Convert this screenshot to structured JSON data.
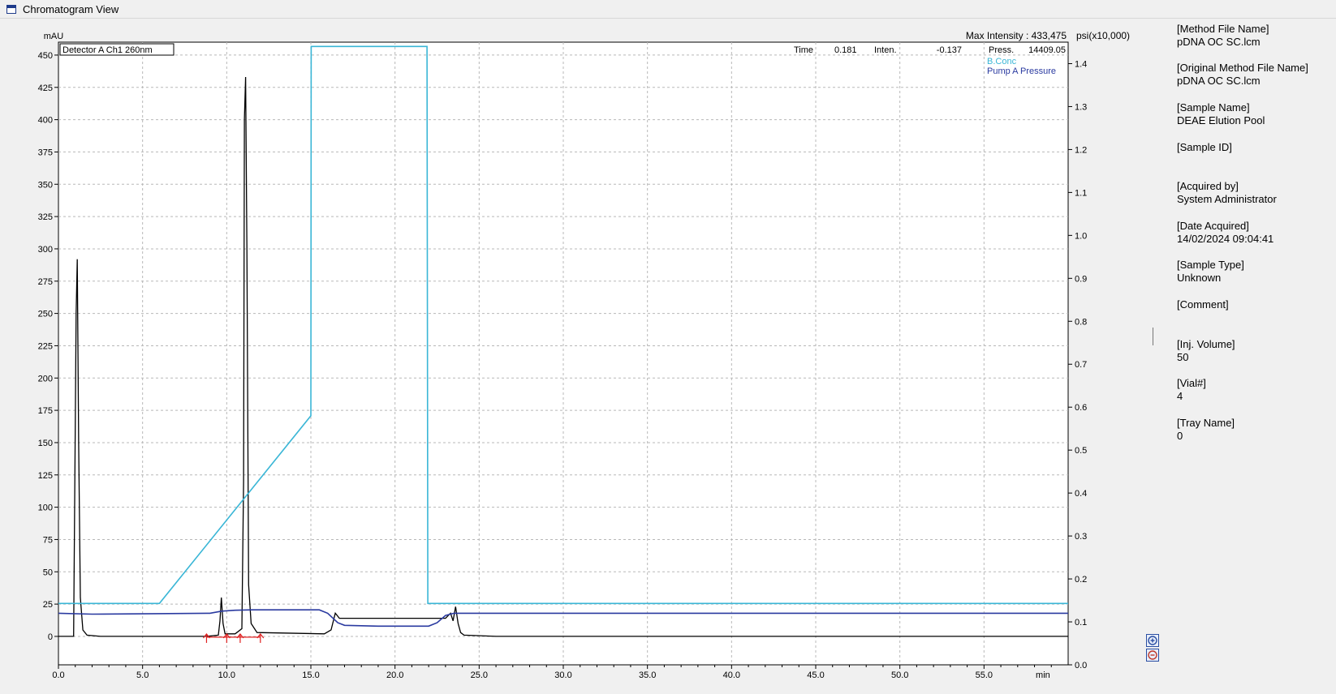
{
  "window": {
    "title": "Chromatogram View"
  },
  "chart_data": {
    "type": "line",
    "xlabel": "min",
    "ylabel_left": "mAU",
    "ylabel_right": "psi(x10,000)",
    "xlim": [
      0,
      60
    ],
    "ylim_left": [
      -22,
      460
    ],
    "ylim_right": [
      0.0,
      1.45
    ],
    "x_ticks": [
      "0.0",
      "5.0",
      "10.0",
      "15.0",
      "20.0",
      "25.0",
      "30.0",
      "35.0",
      "40.0",
      "45.0",
      "50.0",
      "55.0"
    ],
    "y_ticks_left": [
      "0",
      "25",
      "50",
      "75",
      "100",
      "125",
      "150",
      "175",
      "200",
      "225",
      "250",
      "275",
      "300",
      "325",
      "350",
      "375",
      "400",
      "425",
      "450"
    ],
    "y_ticks_right": [
      "0.0",
      "0.1",
      "0.2",
      "0.3",
      "0.4",
      "0.5",
      "0.6",
      "0.7",
      "0.8",
      "0.9",
      "1.0",
      "1.1",
      "1.2",
      "1.3",
      "1.4"
    ],
    "grid": true,
    "detector_label": "Detector A Ch1 260nm",
    "readout": {
      "max_intensity": "Max Intensity : 433,475",
      "time_label": "Time",
      "time_value": "0.181",
      "inten_label": "Inten.",
      "inten_value": "-0.137",
      "press_label": "Press.",
      "press_value": "14409.05"
    },
    "legend": [
      "B.Conc",
      "Pump A Pressure"
    ],
    "series": [
      {
        "name": "Detector A Ch1 260nm",
        "color": "#000000",
        "axis": "left",
        "points": [
          [
            0,
            0
          ],
          [
            0.9,
            0
          ],
          [
            1.0,
            160
          ],
          [
            1.05,
            250
          ],
          [
            1.12,
            292
          ],
          [
            1.2,
            150
          ],
          [
            1.3,
            30
          ],
          [
            1.45,
            5
          ],
          [
            1.7,
            1
          ],
          [
            2.5,
            0
          ],
          [
            8.8,
            0
          ],
          [
            9.5,
            1
          ],
          [
            9.6,
            12
          ],
          [
            9.68,
            30
          ],
          [
            9.78,
            10
          ],
          [
            9.9,
            2
          ],
          [
            10.5,
            2
          ],
          [
            10.9,
            6
          ],
          [
            11.0,
            120
          ],
          [
            11.05,
            400
          ],
          [
            11.12,
            433
          ],
          [
            11.2,
            300
          ],
          [
            11.3,
            40
          ],
          [
            11.45,
            10
          ],
          [
            11.8,
            3
          ],
          [
            15.8,
            2
          ],
          [
            16.2,
            5
          ],
          [
            16.45,
            18
          ],
          [
            16.7,
            14
          ],
          [
            17.0,
            14
          ],
          [
            18.5,
            14
          ],
          [
            21.5,
            14
          ],
          [
            23.0,
            14
          ],
          [
            23.3,
            18
          ],
          [
            23.45,
            12
          ],
          [
            23.6,
            23
          ],
          [
            23.75,
            10
          ],
          [
            23.9,
            3
          ],
          [
            24.1,
            1
          ],
          [
            26,
            0
          ],
          [
            60,
            0
          ]
        ]
      },
      {
        "name": "B.Conc",
        "color": "#3ab6d6",
        "axis": "right",
        "points": [
          [
            0,
            0.143
          ],
          [
            6.0,
            0.143
          ],
          [
            15.0,
            0.58
          ],
          [
            15.02,
            1.44
          ],
          [
            21.9,
            1.44
          ],
          [
            21.95,
            0.143
          ],
          [
            60,
            0.143
          ]
        ]
      },
      {
        "name": "Pump A Pressure",
        "color": "#2a3aa0",
        "axis": "right",
        "points": [
          [
            0,
            0.12
          ],
          [
            2.0,
            0.118
          ],
          [
            9.0,
            0.12
          ],
          [
            9.7,
            0.125
          ],
          [
            10.5,
            0.127
          ],
          [
            11.5,
            0.128
          ],
          [
            15.5,
            0.128
          ],
          [
            16.0,
            0.12
          ],
          [
            16.6,
            0.098
          ],
          [
            17.0,
            0.092
          ],
          [
            19.0,
            0.09
          ],
          [
            22.0,
            0.09
          ],
          [
            22.5,
            0.098
          ],
          [
            23.0,
            0.115
          ],
          [
            23.5,
            0.12
          ],
          [
            60,
            0.12
          ]
        ]
      }
    ],
    "integration_marks": [
      8.8,
      10.0,
      10.8,
      12.0
    ]
  },
  "info_panel": [
    {
      "label": "[Method File Name]",
      "value": "pDNA OC SC.lcm"
    },
    {
      "label": "[Original Method File Name]",
      "value": "pDNA OC SC.lcm"
    },
    {
      "label": "[Sample Name]",
      "value": "DEAE Elution Pool"
    },
    {
      "label": "[Sample ID]",
      "value": ""
    },
    {
      "label": "[Acquired by]",
      "value": "System Administrator"
    },
    {
      "label": "[Date Acquired]",
      "value": "14/02/2024 09:04:41"
    },
    {
      "label": "[Sample Type]",
      "value": "Unknown"
    },
    {
      "label": "[Comment]",
      "value": ""
    },
    {
      "label": "[Inj. Volume]",
      "value": "50"
    },
    {
      "label": "[Vial#]",
      "value": "4"
    },
    {
      "label": "[Tray Name]",
      "value": "0"
    }
  ],
  "zoom": {
    "in": "zoom-in",
    "out": "zoom-out"
  }
}
